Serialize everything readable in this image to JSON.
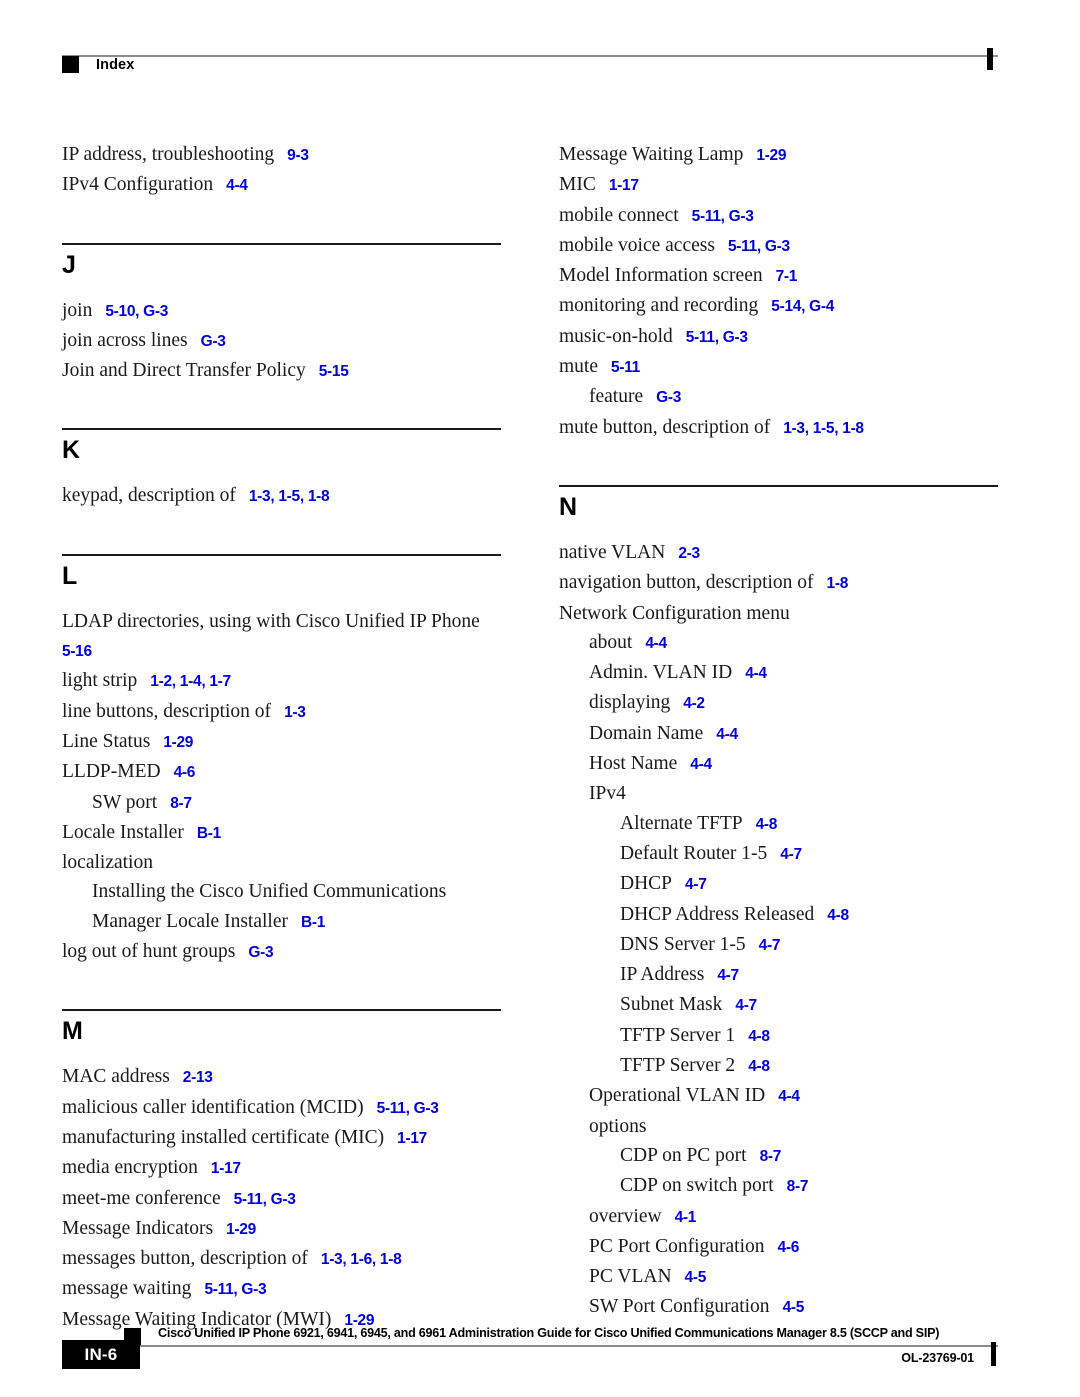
{
  "header": {
    "label": "Index",
    "bullet_icon": "black-square-icon"
  },
  "footer": {
    "page_badge": "IN-6",
    "title": "Cisco Unified IP Phone 6921, 6941, 6945, and 6961 Administration Guide for Cisco Unified Communications Manager 8.5 (SCCP and SIP)",
    "doc_number": "OL-23769-01"
  },
  "colors": {
    "reference_blue": "#0000d6",
    "text_black": "#1a1a1a",
    "rule_gray": "#8c8c8c"
  },
  "left_column": {
    "lead_entries": [
      {
        "text": "IP address, troubleshooting",
        "ref": "9-3",
        "level": 0
      },
      {
        "text": "IPv4 Configuration",
        "ref": "4-4",
        "level": 0
      }
    ],
    "sections": [
      {
        "letter": "J",
        "entries": [
          {
            "text": "join",
            "ref": "5-10, G-3",
            "level": 0
          },
          {
            "text": "join across lines",
            "ref": "G-3",
            "level": 0
          },
          {
            "text": "Join and Direct Transfer Policy",
            "ref": "5-15",
            "level": 0
          }
        ]
      },
      {
        "letter": "K",
        "entries": [
          {
            "text": "keypad, description of",
            "ref": "1-3, 1-5, 1-8",
            "level": 0
          }
        ]
      },
      {
        "letter": "L",
        "entries": [
          {
            "text": "LDAP directories, using with Cisco Unified IP Phone",
            "ref": "5-16",
            "level": 0
          },
          {
            "text": "light strip",
            "ref": "1-2, 1-4, 1-7",
            "level": 0
          },
          {
            "text": "line buttons, description of",
            "ref": "1-3",
            "level": 0
          },
          {
            "text": "Line Status",
            "ref": "1-29",
            "level": 0
          },
          {
            "text": "LLDP-MED",
            "ref": "4-6",
            "level": 0
          },
          {
            "text": "SW port",
            "ref": "8-7",
            "level": 1
          },
          {
            "text": "Locale Installer",
            "ref": "B-1",
            "level": 0
          },
          {
            "text": "localization",
            "ref": "",
            "level": 0
          },
          {
            "text": "Installing the Cisco Unified Communications Manager Locale Installer",
            "ref": "B-1",
            "level": 1
          },
          {
            "text": "log out of hunt groups",
            "ref": "G-3",
            "level": 0
          }
        ]
      },
      {
        "letter": "M",
        "entries": [
          {
            "text": "MAC address",
            "ref": "2-13",
            "level": 0
          },
          {
            "text": "malicious caller identification (MCID)",
            "ref": "5-11, G-3",
            "level": 0
          },
          {
            "text": "manufacturing installed certificate (MIC)",
            "ref": "1-17",
            "level": 0
          },
          {
            "text": "media encryption",
            "ref": "1-17",
            "level": 0
          },
          {
            "text": "meet-me conference",
            "ref": "5-11, G-3",
            "level": 0
          },
          {
            "text": "Message Indicators",
            "ref": "1-29",
            "level": 0
          },
          {
            "text": "messages button, description of",
            "ref": "1-3, 1-6, 1-8",
            "level": 0
          },
          {
            "text": "message waiting",
            "ref": "5-11, G-3",
            "level": 0
          },
          {
            "text": "Message Waiting Indicator (MWI)",
            "ref": "1-29",
            "level": 0
          }
        ]
      }
    ]
  },
  "right_column": {
    "lead_entries": [
      {
        "text": "Message Waiting Lamp",
        "ref": "1-29",
        "level": 0
      },
      {
        "text": "MIC",
        "ref": "1-17",
        "level": 0
      },
      {
        "text": "mobile connect",
        "ref": "5-11, G-3",
        "level": 0
      },
      {
        "text": "mobile voice access",
        "ref": "5-11, G-3",
        "level": 0
      },
      {
        "text": "Model Information screen",
        "ref": "7-1",
        "level": 0
      },
      {
        "text": "monitoring and recording",
        "ref": "5-14, G-4",
        "level": 0
      },
      {
        "text": "music-on-hold",
        "ref": "5-11, G-3",
        "level": 0
      },
      {
        "text": "mute",
        "ref": "5-11",
        "level": 0
      },
      {
        "text": "feature",
        "ref": "G-3",
        "level": 1
      },
      {
        "text": "mute button, description of",
        "ref": "1-3, 1-5, 1-8",
        "level": 0
      }
    ],
    "sections": [
      {
        "letter": "N",
        "entries": [
          {
            "text": "native VLAN",
            "ref": "2-3",
            "level": 0
          },
          {
            "text": "navigation button, description of",
            "ref": "1-8",
            "level": 0
          },
          {
            "text": "Network Configuration menu",
            "ref": "",
            "level": 0
          },
          {
            "text": "about",
            "ref": "4-4",
            "level": 1
          },
          {
            "text": "Admin. VLAN ID",
            "ref": "4-4",
            "level": 1
          },
          {
            "text": "displaying",
            "ref": "4-2",
            "level": 1
          },
          {
            "text": "Domain Name",
            "ref": "4-4",
            "level": 1
          },
          {
            "text": "Host Name",
            "ref": "4-4",
            "level": 1
          },
          {
            "text": "IPv4",
            "ref": "",
            "level": 1
          },
          {
            "text": "Alternate TFTP",
            "ref": "4-8",
            "level": 2
          },
          {
            "text": "Default Router 1-5",
            "ref": "4-7",
            "level": 2
          },
          {
            "text": "DHCP",
            "ref": "4-7",
            "level": 2
          },
          {
            "text": "DHCP Address Released",
            "ref": "4-8",
            "level": 2
          },
          {
            "text": "DNS Server 1-5",
            "ref": "4-7",
            "level": 2
          },
          {
            "text": "IP Address",
            "ref": "4-7",
            "level": 2
          },
          {
            "text": "Subnet Mask",
            "ref": "4-7",
            "level": 2
          },
          {
            "text": "TFTP Server 1",
            "ref": "4-8",
            "level": 2
          },
          {
            "text": "TFTP Server 2",
            "ref": "4-8",
            "level": 2
          },
          {
            "text": "Operational VLAN ID",
            "ref": "4-4",
            "level": 1
          },
          {
            "text": "options",
            "ref": "",
            "level": 1
          },
          {
            "text": "CDP on PC port",
            "ref": "8-7",
            "level": 2
          },
          {
            "text": "CDP on switch port",
            "ref": "8-7",
            "level": 2
          },
          {
            "text": "overview",
            "ref": "4-1",
            "level": 1
          },
          {
            "text": "PC Port Configuration",
            "ref": "4-6",
            "level": 1
          },
          {
            "text": "PC VLAN",
            "ref": "4-5",
            "level": 1
          },
          {
            "text": "SW Port Configuration",
            "ref": "4-5",
            "level": 1
          }
        ]
      }
    ]
  }
}
